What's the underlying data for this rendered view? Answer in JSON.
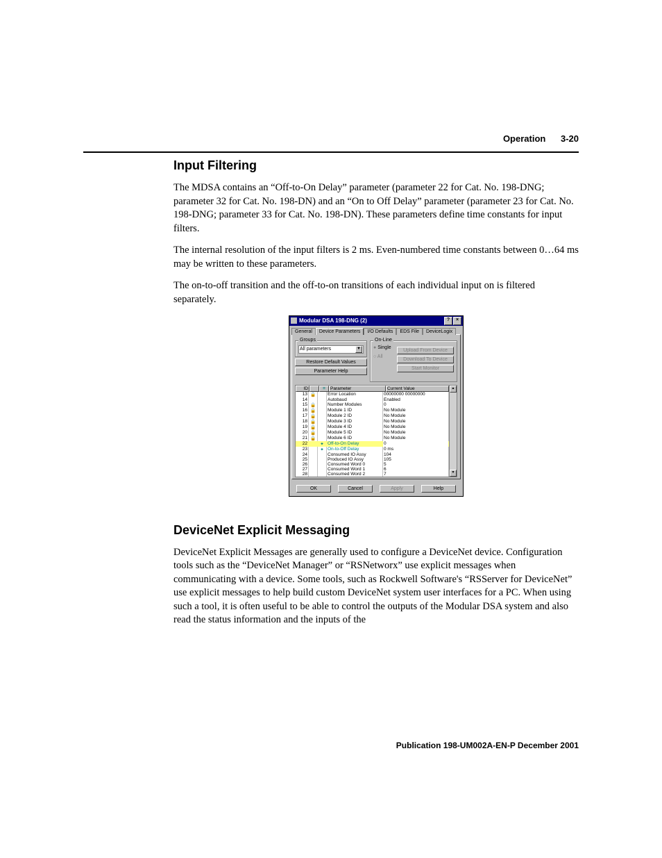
{
  "header": {
    "section": "Operation",
    "page": "3-20"
  },
  "h1": "Input Filtering",
  "p1": "The MDSA contains an “Off-to-On Delay” parameter (parameter 22 for Cat. No. 198-DNG; parameter 32 for Cat. No. 198-DN) and an “On to Off Delay” parameter (parameter 23 for Cat. No. 198-DNG; parameter 33 for Cat. No. 198-DN). These parameters define time constants for input filters.",
  "p2": "The internal resolution of the input filters is 2 ms. Even-numbered time constants between 0…64 ms may be written to these parameters.",
  "p3": "The on-to-off transition and the off-to-on transitions of each individual input on is filtered separately.",
  "h2": "DeviceNet Explicit Messaging",
  "p4": "DeviceNet Explicit Messages are generally used to configure a DeviceNet device. Configuration tools such as the “DeviceNet Manager” or “RSNetworx” use explicit messages when communicating with a device. Some tools, such as Rockwell Software's “RSServer for DeviceNet” use explicit messages to help build custom DeviceNet system user interfaces for a PC. When using such a tool, it is often useful to be able to control the outputs of the Modular DSA system and also read the status information and the inputs of the",
  "footer": "Publication 198-UM002A-EN-P  December 2001",
  "dialog": {
    "title": "Modular DSA 198-DNG (2)",
    "help_btn": "?",
    "close_btn": "×",
    "tabs": [
      "General",
      "Device Parameters",
      "I/O Defaults",
      "EDS File",
      "DeviceLogix"
    ],
    "active_tab": "Device Parameters",
    "groups_label": "Groups",
    "groups_value": "All parameters",
    "restore_btn": "Restore Default Values",
    "paramhelp_btn": "Parameter Help",
    "online_label": "On-Line",
    "radio_single": "Single",
    "radio_all": "All",
    "upload_btn": "Upload From Device",
    "download_btn": "Download To Device",
    "monitor_btn": "Start Monitor",
    "columns": {
      "id": "ID",
      "lock": "",
      "eq": "≡",
      "param": "Parameter",
      "value": "Current Value"
    },
    "rows": [
      {
        "id": "13",
        "lock": "🔒",
        "eq": "",
        "param": "Error Location",
        "value": "00000000 00000000"
      },
      {
        "id": "14",
        "lock": "",
        "eq": "",
        "param": "Autobaud",
        "value": "Enabled"
      },
      {
        "id": "15",
        "lock": "🔒",
        "eq": "",
        "param": "Number Modules",
        "value": "0"
      },
      {
        "id": "16",
        "lock": "🔒",
        "eq": "",
        "param": "Module 1 ID",
        "value": "No Module"
      },
      {
        "id": "17",
        "lock": "🔒",
        "eq": "",
        "param": "Module 2 ID",
        "value": "No Module"
      },
      {
        "id": "18",
        "lock": "🔒",
        "eq": "",
        "param": "Module 3 ID",
        "value": "No Module"
      },
      {
        "id": "19",
        "lock": "🔒",
        "eq": "",
        "param": "Module 4 ID",
        "value": "No Module"
      },
      {
        "id": "20",
        "lock": "🔒",
        "eq": "",
        "param": "Module 5 ID",
        "value": "No Module"
      },
      {
        "id": "21",
        "lock": "🔒",
        "eq": "",
        "param": "Module 6 ID",
        "value": "No Module"
      },
      {
        "id": "22",
        "lock": "",
        "eq": "✦",
        "param": "Off-to-On Delay",
        "value": "0",
        "selected": true
      },
      {
        "id": "23",
        "lock": "",
        "eq": "✦",
        "param": "On-to-Off Delay",
        "value": "0 ms"
      },
      {
        "id": "24",
        "lock": "",
        "eq": "",
        "param": "Consumed IO Assy",
        "value": "104"
      },
      {
        "id": "25",
        "lock": "",
        "eq": "",
        "param": "Produced IO Assy",
        "value": "105"
      },
      {
        "id": "26",
        "lock": "",
        "eq": "",
        "param": "Consumed Word 0",
        "value": "5"
      },
      {
        "id": "27",
        "lock": "",
        "eq": "",
        "param": "Consumed Word 1",
        "value": "6"
      },
      {
        "id": "28",
        "lock": "",
        "eq": "",
        "param": "Consumed Word 2",
        "value": "7"
      }
    ],
    "ok": "OK",
    "cancel": "Cancel",
    "apply": "Apply",
    "help": "Help"
  }
}
